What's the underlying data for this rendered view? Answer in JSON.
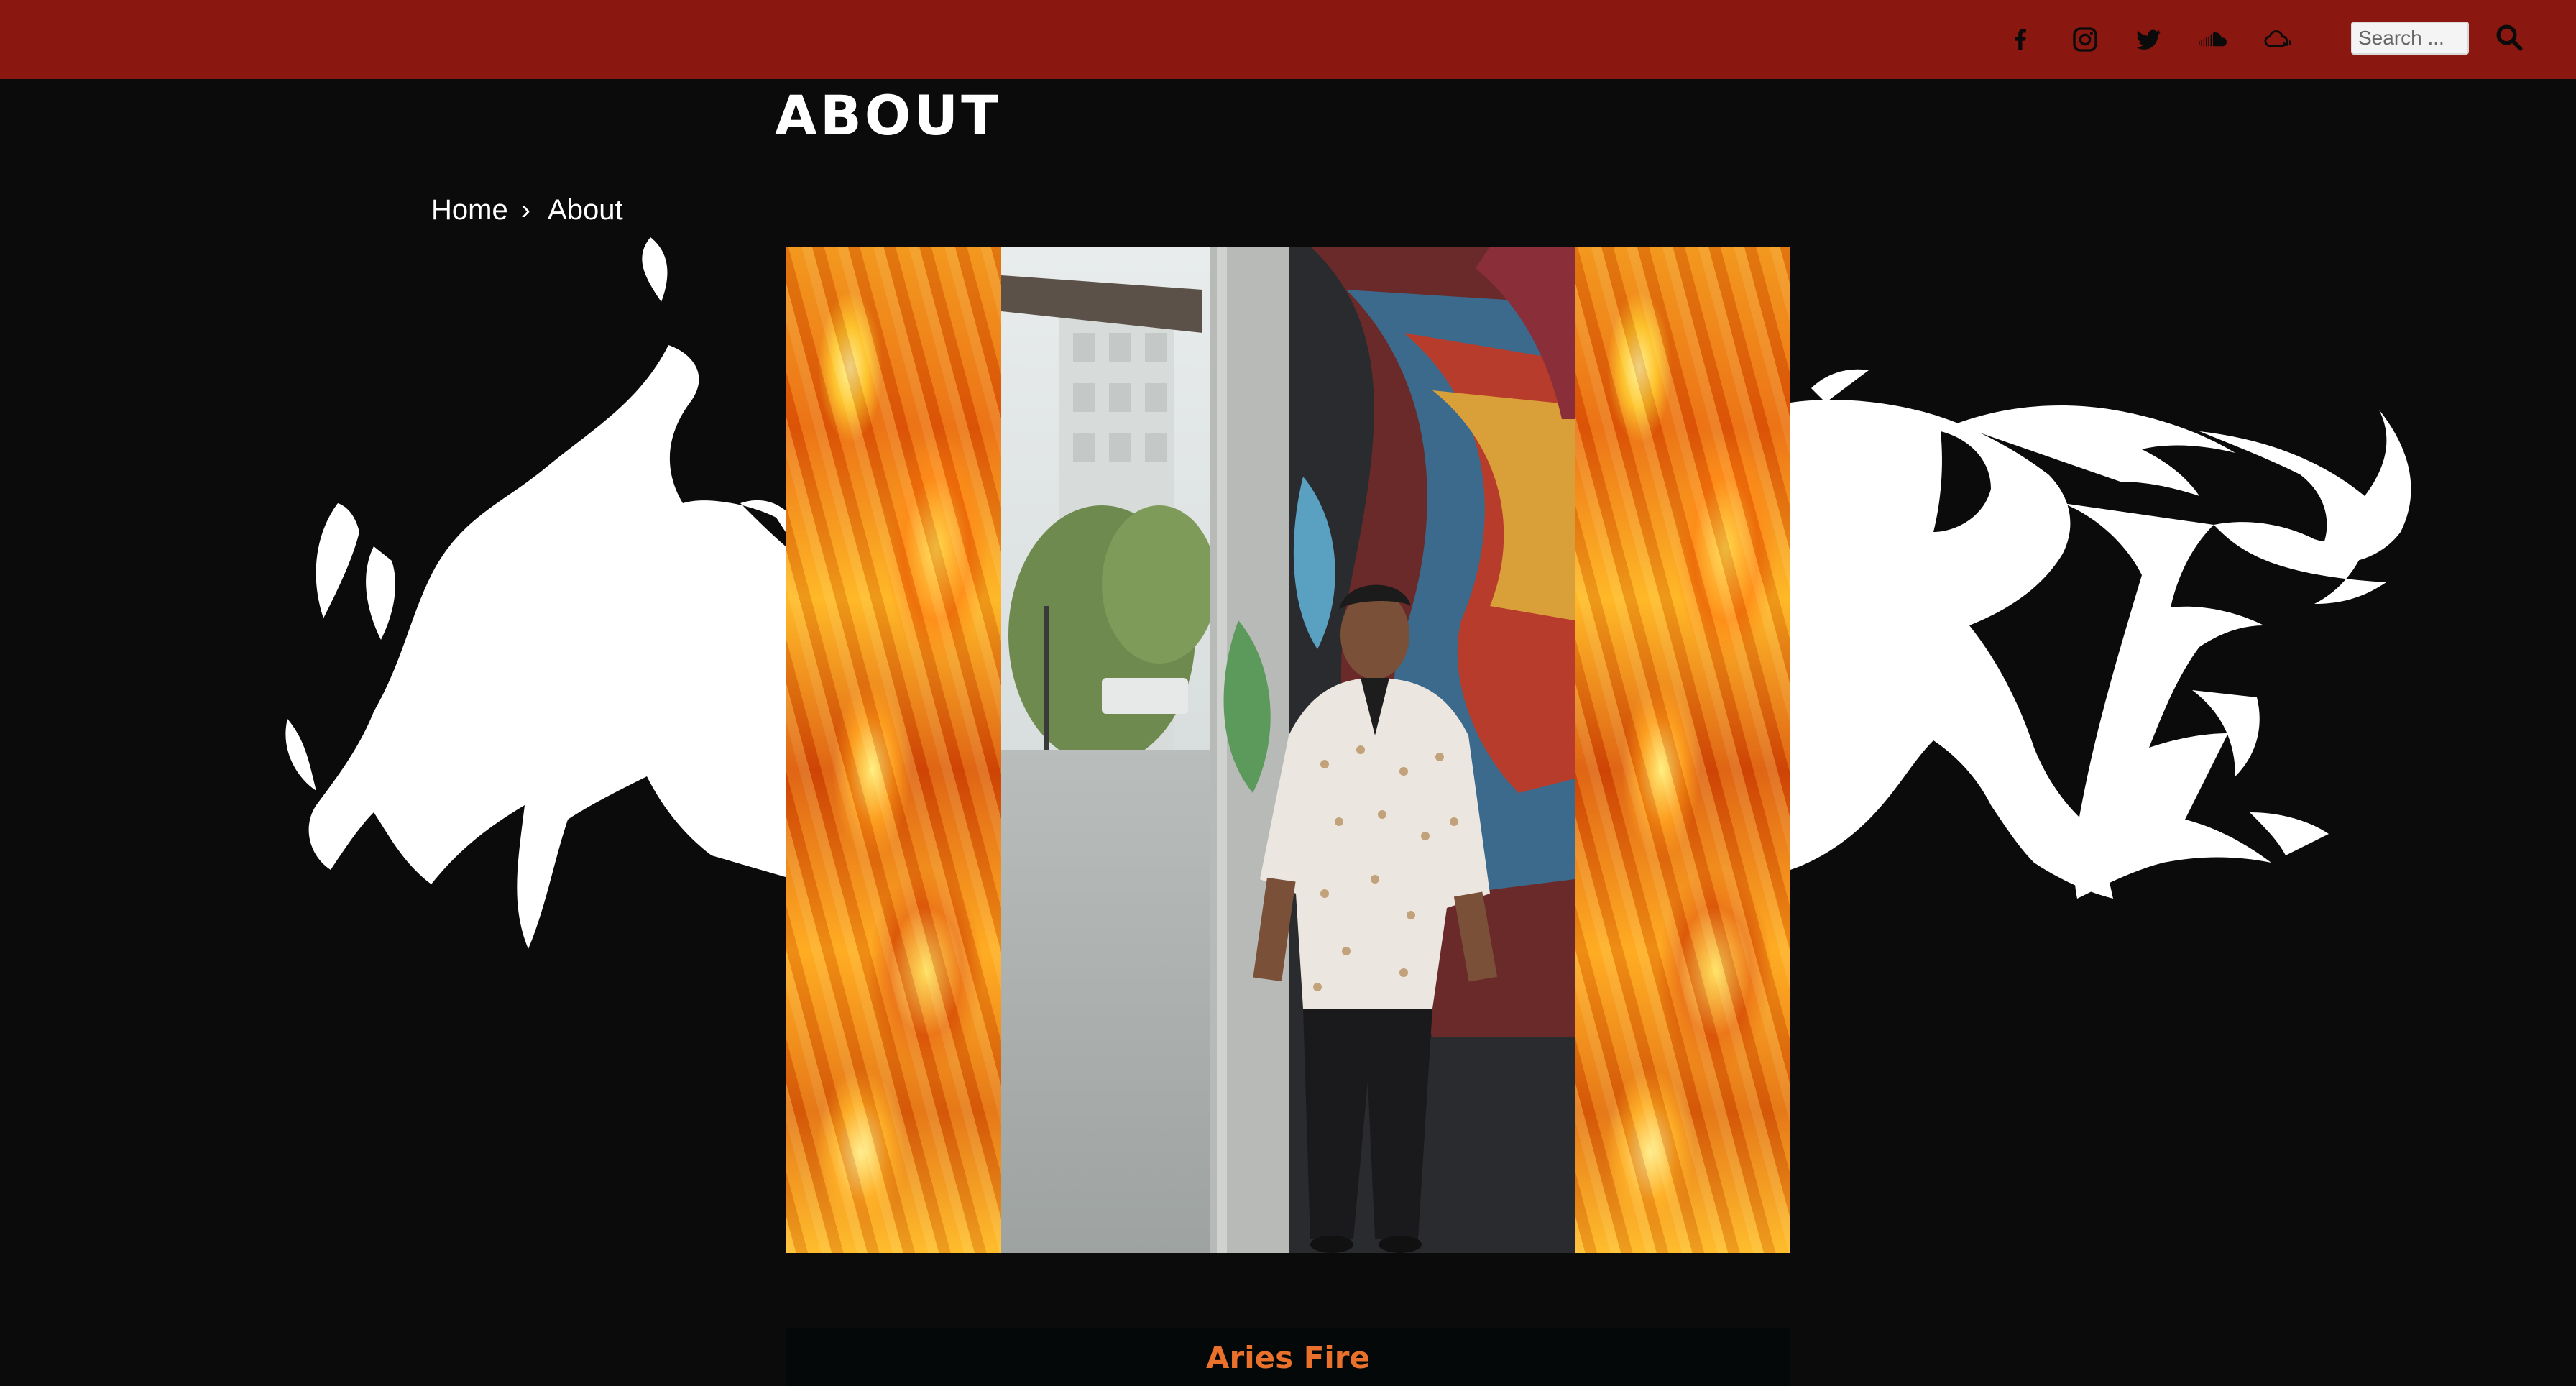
{
  "header": {
    "social_icons": [
      {
        "name": "facebook-icon"
      },
      {
        "name": "instagram-icon"
      },
      {
        "name": "twitter-icon"
      },
      {
        "name": "soundcloud-icon"
      },
      {
        "name": "audiomack-icon"
      }
    ],
    "search": {
      "placeholder": "Search ...",
      "value": ""
    },
    "bar_color": "#8a1810"
  },
  "page": {
    "title": "ABOUT"
  },
  "breadcrumb": {
    "home_label": "Home",
    "separator": "›",
    "current_label": "About"
  },
  "logo": {
    "text": "Aries Fire"
  },
  "caption": {
    "text": "Aries Fire",
    "color": "#e9712b"
  }
}
